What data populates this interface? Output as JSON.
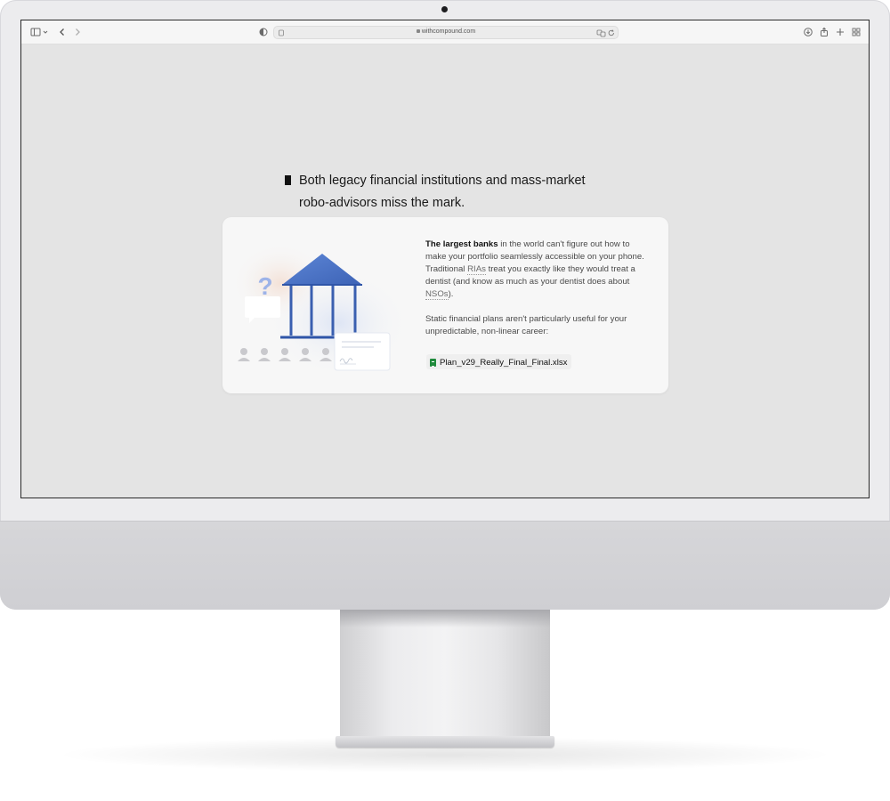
{
  "browser": {
    "url": "withcompound.com",
    "icons": [
      "sidebar-icon",
      "chevron-down-icon",
      "back-icon",
      "forward-icon",
      "privacy-shield-icon",
      "page-icon",
      "translate-icon",
      "reload-icon",
      "download-icon",
      "share-icon",
      "new-tab-icon",
      "tab-overview-icon"
    ]
  },
  "headline": {
    "line1": "Both legacy financial institutions and mass-market",
    "line2": "robo-advisors miss the mark."
  },
  "card": {
    "p1_bold": "The largest banks",
    "p1_a": " in the world can't figure out how to make your portfolio seamlessly accessible on your phone. Traditional ",
    "p1_rias": "RIAs",
    "p1_b": " treat you exactly like they would treat a dentist (and know as much as your dentist does about ",
    "p1_nsos": "NSOs",
    "p1_c": ").",
    "p2": "Static financial plans aren't particularly useful for your unpredictable, non-linear career:",
    "file_name": "Plan_v29_Really_Final_Final.xlsx",
    "illustration": {
      "question_mark": "?",
      "people_count": 5,
      "colors": {
        "roof": "#4a72c4",
        "columns": "#3a5fb0",
        "question": "#9db3e8",
        "people": "#c9c9cd"
      }
    }
  }
}
